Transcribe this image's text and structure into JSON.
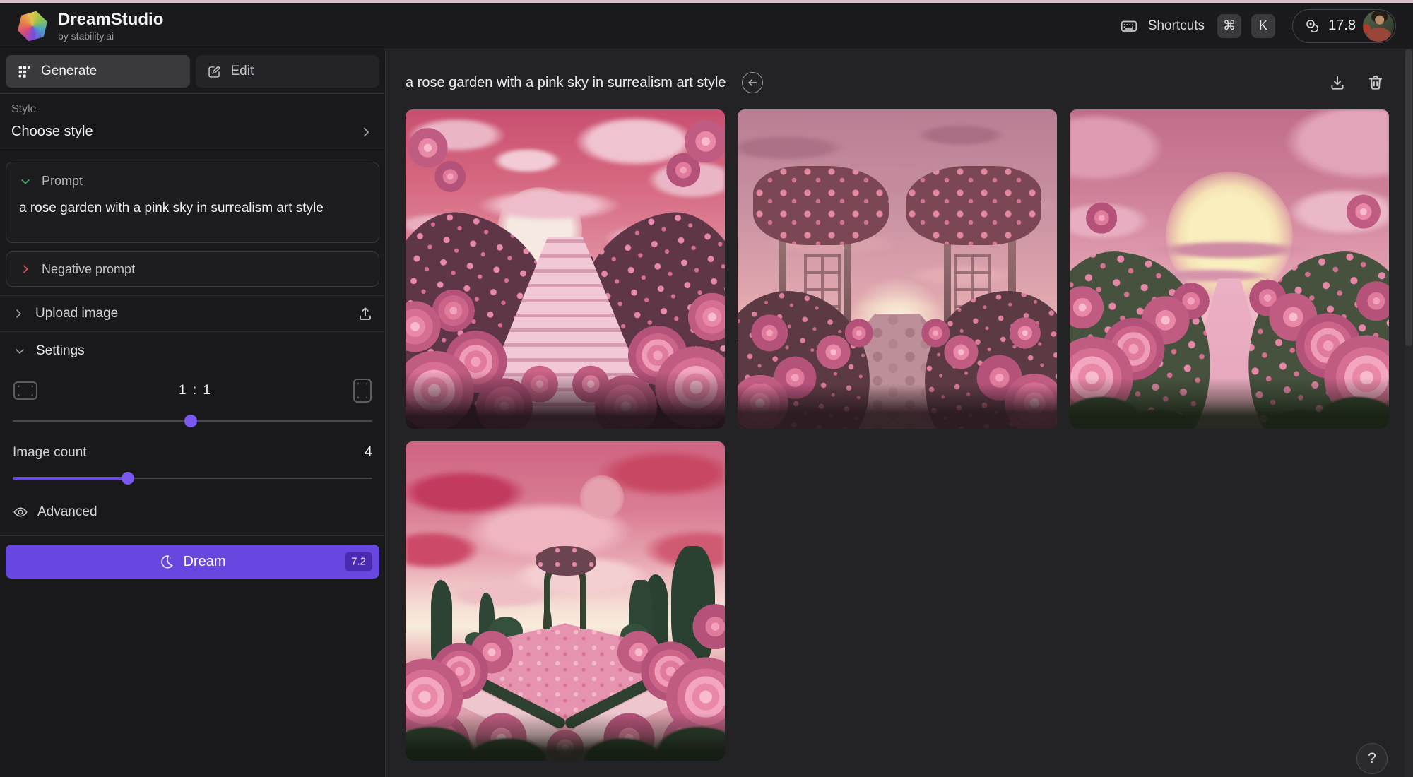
{
  "topbar": {
    "app_name": "DreamStudio",
    "app_subtitle": "by stability.ai",
    "shortcuts_label": "Shortcuts",
    "key_cmd": "⌘",
    "key_k": "K",
    "credits": "17.8"
  },
  "sidebar": {
    "tab_generate": "Generate",
    "tab_edit": "Edit",
    "style_label": "Style",
    "style_value": "Choose style",
    "prompt_label": "Prompt",
    "prompt_value": "a rose garden with a pink sky in surrealism art style",
    "negative_prompt_label": "Negative prompt",
    "upload_label": "Upload image",
    "settings_label": "Settings",
    "aspect_ratio": "1 : 1",
    "image_count_label": "Image count",
    "image_count_value": "4",
    "advanced_label": "Advanced",
    "dream_label": "Dream",
    "dream_cost": "7.2"
  },
  "main": {
    "title": "a rose garden with a pink sky in surrealism art style",
    "help_label": "?",
    "images": [
      {
        "desc": "Rose garden with central staircase, cypress trees and pale moon in a pink sky"
      },
      {
        "desc": "Two rose-covered pergolas flanking a cobblestone path at pink sunset"
      },
      {
        "desc": "Rose-lined pink path leading toward a large glowing sun"
      },
      {
        "desc": "Formal rose garden with arch, cypress trees and dramatic pink clouds"
      }
    ]
  },
  "colors": {
    "accent_purple": "#6847e0",
    "top_line_pink": "#d9bfc7",
    "chevron_green": "#3fae68",
    "chevron_red": "#d94f4f"
  }
}
